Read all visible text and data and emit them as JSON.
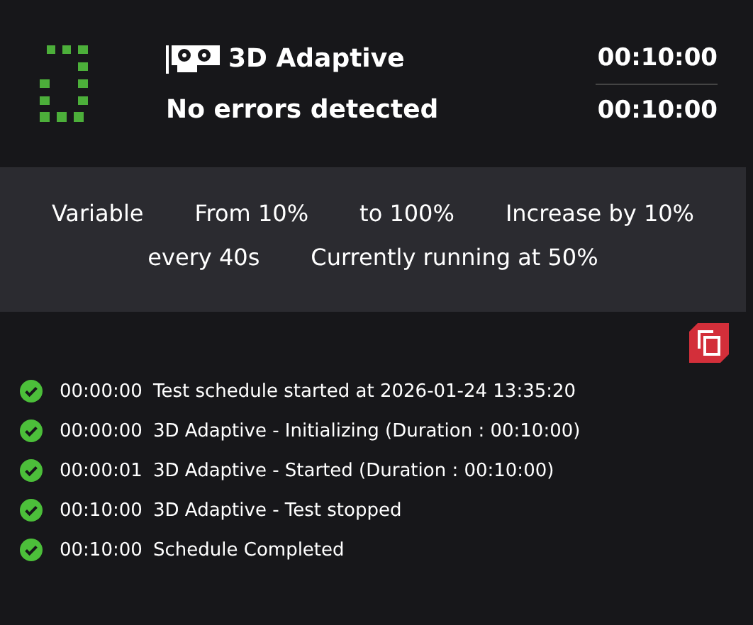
{
  "test": {
    "name": "3D Adaptive",
    "status": "No errors detected",
    "elapsed": "00:10:00",
    "duration": "00:10:00"
  },
  "settings": [
    "Variable",
    "From 10%",
    "to 100%",
    "Increase by 10%",
    "every 40s",
    "Currently running at 50%"
  ],
  "log": [
    {
      "time": "00:00:00",
      "message": "Test schedule started at 2026-01-24 13:35:20"
    },
    {
      "time": "00:00:00",
      "message": "3D Adaptive - Initializing (Duration : 00:10:00)"
    },
    {
      "time": "00:00:01",
      "message": "3D Adaptive - Started (Duration : 00:10:00)"
    },
    {
      "time": "00:10:00",
      "message": "3D Adaptive - Test stopped"
    },
    {
      "time": "00:10:00",
      "message": "Schedule Completed"
    }
  ]
}
